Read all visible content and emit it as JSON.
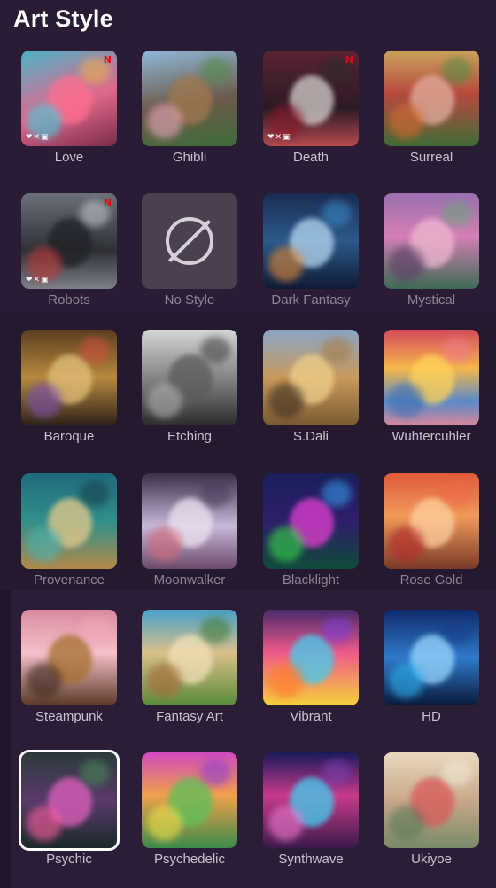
{
  "title": "Art Style",
  "styles": [
    {
      "label": "Love",
      "icon": "heart-robot-art",
      "badge": "N",
      "overlay": "❤✕▣"
    },
    {
      "label": "Ghibli",
      "icon": "castle-art"
    },
    {
      "label": "Death",
      "icon": "reaper-art",
      "badge": "N",
      "overlay": "❤✕▣"
    },
    {
      "label": "Surreal",
      "icon": "volcano-art"
    },
    {
      "label": "Robots",
      "icon": "mech-art",
      "badge": "N",
      "overlay": "❤✕▣"
    },
    {
      "label": "No Style",
      "icon": "prohibited-icon"
    },
    {
      "label": "Dark Fantasy",
      "icon": "spirit-art"
    },
    {
      "label": "Mystical",
      "icon": "temple-art"
    },
    {
      "label": "Baroque",
      "icon": "ornate-art"
    },
    {
      "label": "Etching",
      "icon": "etching-art"
    },
    {
      "label": "S.Dali",
      "icon": "dali-art"
    },
    {
      "label": "Wuhtercuhler",
      "icon": "sunset-art"
    },
    {
      "label": "Provenance",
      "icon": "swirl-art"
    },
    {
      "label": "Moonwalker",
      "icon": "astronaut-art"
    },
    {
      "label": "Blacklight",
      "icon": "neon-forest-art"
    },
    {
      "label": "Rose Gold",
      "icon": "pagoda-art"
    },
    {
      "label": "Steampunk",
      "icon": "steampunk-art"
    },
    {
      "label": "Fantasy Art",
      "icon": "tower-art"
    },
    {
      "label": "Vibrant",
      "icon": "flame-flower-art"
    },
    {
      "label": "HD",
      "icon": "ice-art"
    },
    {
      "label": "Psychic",
      "icon": "psychic-creature-art"
    },
    {
      "label": "Psychedelic",
      "icon": "tree-art"
    },
    {
      "label": "Synthwave",
      "icon": "retro-face-art"
    },
    {
      "label": "Ukiyoe",
      "icon": "mountains-art"
    }
  ],
  "selected": "Psychic",
  "colors": {
    "background": "#24172e",
    "label": "#c9c3cf",
    "selected_border": "#ffffff",
    "badge": "#e50914"
  }
}
